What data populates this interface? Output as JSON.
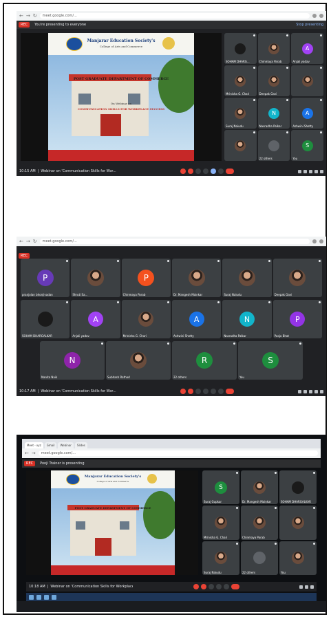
{
  "browser": {
    "url": "meet.google.com/..."
  },
  "rec_label": "REC",
  "shot1": {
    "presenting_text": "You're presenting to everyone",
    "stop_label": "Stop presenting",
    "slide": {
      "society": "Manjarar Education Society's",
      "college": "College of Arts and Commerce",
      "dept": "POST GRADUATE DEPARTMENT OF COMMERCE",
      "webinar_on": "On Webinar on",
      "topic": "COMMUNICATION SKILLS FOR WORKPLACE SUCCESS"
    },
    "tiles": [
      {
        "name": "SOHAM DHARG...",
        "kind": "avatar",
        "letter": "",
        "color": "#1a1a1a"
      },
      {
        "name": "Chinmaya Parab",
        "kind": "photo",
        "letter": "",
        "color": ""
      },
      {
        "name": "Anjali yadav",
        "kind": "avatar",
        "letter": "A",
        "color": "#a142f4"
      },
      {
        "name": "Mrinisha G. Chari",
        "kind": "photo",
        "letter": "",
        "color": ""
      },
      {
        "name": "Deepak Gavi",
        "kind": "photo",
        "letter": "",
        "color": ""
      },
      {
        "name": "",
        "kind": "photo",
        "letter": "",
        "color": ""
      },
      {
        "name": "Suraj Naiudu",
        "kind": "photo",
        "letter": "",
        "color": ""
      },
      {
        "name": "Nasradha Palkar",
        "kind": "avatar",
        "letter": "N",
        "color": "#12b5cb"
      },
      {
        "name": "Ashwini Shetty",
        "kind": "avatar",
        "letter": "A",
        "color": "#1a73e8"
      },
      {
        "name": "",
        "kind": "photo",
        "letter": "",
        "color": ""
      },
      {
        "name": "22 others",
        "kind": "avatar",
        "letter": "",
        "color": "#5f6368"
      },
      {
        "name": "You",
        "kind": "avatar",
        "letter": "S",
        "color": "#1e8e3e"
      }
    ],
    "time": "10:15 AM",
    "meeting_title": "Webinar on 'Communication Skills for Wor..."
  },
  "shot2": {
    "tiles_row1": [
      {
        "name": "pranjolan bhonjivadan",
        "kind": "avatar",
        "letter": "P",
        "color": "#673ab7"
      },
      {
        "name": "Shruti Sa...",
        "kind": "photo",
        "letter": "",
        "color": ""
      },
      {
        "name": "Chinmaya Parab",
        "kind": "avatar",
        "letter": "P",
        "color": "#f4511e"
      },
      {
        "name": "Dr. Mangesh Mainkar",
        "kind": "photo",
        "letter": "",
        "color": ""
      },
      {
        "name": "Suraj Naiudu",
        "kind": "photo",
        "letter": "",
        "color": ""
      },
      {
        "name": "Deepak Gavi",
        "kind": "photo",
        "letter": "",
        "color": ""
      }
    ],
    "tiles_row2": [
      {
        "name": "SOHAM DHARGALKAR",
        "kind": "avatar",
        "letter": "",
        "color": "#1a1a1a"
      },
      {
        "name": "Anjali yadav",
        "kind": "avatar",
        "letter": "A",
        "color": "#a142f4"
      },
      {
        "name": "Mrinisha G. Chari",
        "kind": "photo",
        "letter": "",
        "color": ""
      },
      {
        "name": "Ashwini Shetty",
        "kind": "avatar",
        "letter": "A",
        "color": "#1a73e8"
      },
      {
        "name": "Nasradha Palkar",
        "kind": "avatar",
        "letter": "N",
        "color": "#12b5cb"
      },
      {
        "name": "Pooja Bhat",
        "kind": "avatar",
        "letter": "P",
        "color": "#9334e6"
      }
    ],
    "tiles_row3": [
      {
        "name": "Nanita Naik",
        "kind": "avatar",
        "letter": "N",
        "color": "#8e24aa"
      },
      {
        "name": "Subhash Rathod",
        "kind": "photo",
        "letter": "",
        "color": ""
      },
      {
        "name": "22 others",
        "kind": "avatar",
        "letter": "R",
        "color": "#1e8e3e"
      },
      {
        "name": "You",
        "kind": "avatar",
        "letter": "S",
        "color": "#1e8e3e"
      }
    ],
    "time": "10:17 AM",
    "meeting_title": "Webinar on 'Communication Skills for Wor..."
  },
  "shot3": {
    "presenting_text": "Pooji Trainer is presenting",
    "tabs": [
      "Meet - xyz",
      "Gmail",
      "Webinar",
      "Slides"
    ],
    "tiles": [
      {
        "name": "Suraj Gupkar",
        "kind": "avatar",
        "letter": "S",
        "color": "#1e8e3e"
      },
      {
        "name": "Dr. Mangesh Mainkar",
        "kind": "photo",
        "letter": "",
        "color": ""
      },
      {
        "name": "SOHAM DHARGALKAR",
        "kind": "avatar",
        "letter": "",
        "color": "#1a1a1a"
      },
      {
        "name": "Mrinisha G. Chari",
        "kind": "photo",
        "letter": "",
        "color": ""
      },
      {
        "name": "Chinmaya Parab",
        "kind": "photo",
        "letter": "",
        "color": ""
      },
      {
        "name": "",
        "kind": "photo",
        "letter": "",
        "color": ""
      },
      {
        "name": "Suraj Naiudu",
        "kind": "photo",
        "letter": "",
        "color": ""
      },
      {
        "name": "22 others",
        "kind": "avatar",
        "letter": "",
        "color": "#5f6368"
      },
      {
        "name": "You",
        "kind": "photo",
        "letter": "",
        "color": ""
      }
    ],
    "time": "10:18 AM",
    "meeting_title": "Webinar on 'Communication Skills for Workplace..."
  }
}
